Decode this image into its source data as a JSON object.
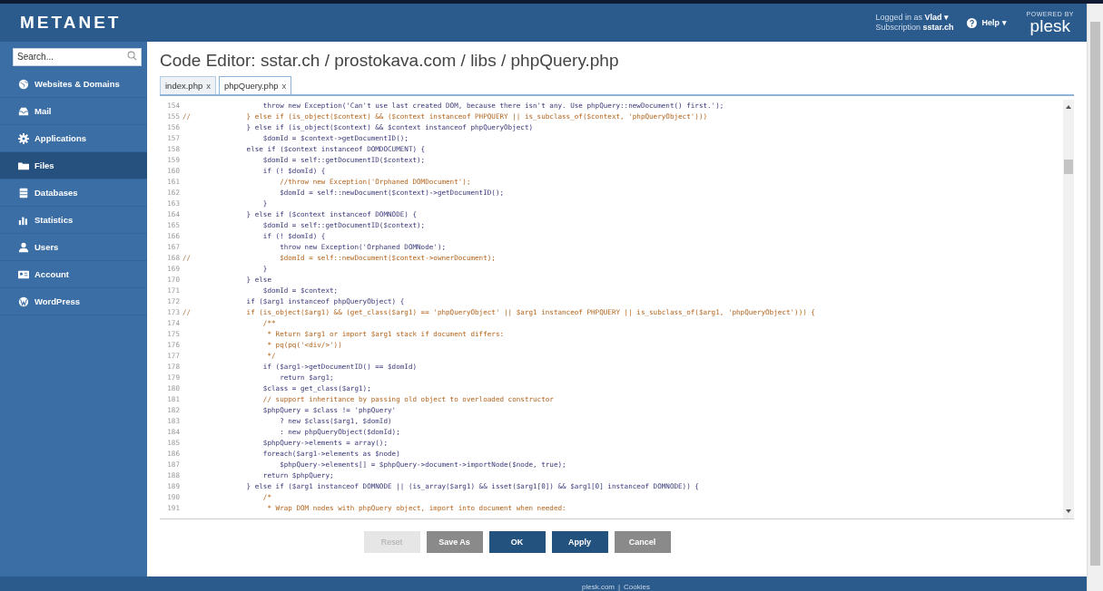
{
  "header": {
    "logo": "METANET",
    "logged_in_label": "Logged in as",
    "user": "Vlad ▾",
    "subscription_label": "Subscription",
    "subscription": "sstar.ch",
    "help": "Help ▾",
    "powered_by": "POWERED BY",
    "brand": "plesk"
  },
  "sidebar": {
    "search": {
      "placeholder": "Search..."
    },
    "items": [
      {
        "label": "Websites & Domains",
        "selected": false
      },
      {
        "label": "Mail",
        "selected": false
      },
      {
        "label": "Applications",
        "selected": false
      },
      {
        "label": "Files",
        "selected": true
      },
      {
        "label": "Databases",
        "selected": false
      },
      {
        "label": "Statistics",
        "selected": false
      },
      {
        "label": "Users",
        "selected": false
      },
      {
        "label": "Account",
        "selected": false
      },
      {
        "label": "WordPress",
        "selected": false
      }
    ]
  },
  "title": "Code Editor: sstar.ch / prostokava.com / libs / phpQuery.php",
  "tabs": [
    {
      "label": "index.php",
      "close": "x",
      "selected": false
    },
    {
      "label": "phpQuery.php",
      "close": "x",
      "selected": true
    }
  ],
  "editor": {
    "lines": [
      {
        "number": "154",
        "kind": "code",
        "text": "            throw new Exception('Can't use last created DOM, because there isn't any. Use phpQuery::newDocument() first.');"
      },
      {
        "number": "155",
        "marker": "//",
        "kind": "comment",
        "text": "        } else if (is_object($context) && ($context instanceof PHPQUERY || is_subclass_of($context, 'phpQueryObject')))"
      },
      {
        "number": "156",
        "kind": "code",
        "text": "        } else if (is_object($context) && $context instanceof phpQueryObject)"
      },
      {
        "number": "157",
        "kind": "code",
        "text": "            $domId = $context->getDocumentID();"
      },
      {
        "number": "158",
        "kind": "code",
        "text": "        else if ($context instanceof DOMDOCUMENT) {"
      },
      {
        "number": "159",
        "kind": "code",
        "text": "            $domId = self::getDocumentID($context);"
      },
      {
        "number": "160",
        "kind": "code",
        "text": "            if (! $domId) {"
      },
      {
        "number": "161",
        "kind": "comment",
        "text": "                //throw new Exception('Orphaned DOMDocument');"
      },
      {
        "number": "162",
        "kind": "code",
        "text": "                $domId = self::newDocument($context)->getDocumentID();"
      },
      {
        "number": "163",
        "kind": "code",
        "text": "            }"
      },
      {
        "number": "164",
        "kind": "code",
        "text": "        } else if ($context instanceof DOMNODE) {"
      },
      {
        "number": "165",
        "kind": "code",
        "text": "            $domId = self::getDocumentID($context);"
      },
      {
        "number": "166",
        "kind": "code",
        "text": "            if (! $domId) {"
      },
      {
        "number": "167",
        "kind": "code",
        "text": "                throw new Exception('Orphaned DOMNode');"
      },
      {
        "number": "168",
        "marker": "//",
        "kind": "comment",
        "text": "                $domId = self::newDocument($context->ownerDocument);"
      },
      {
        "number": "169",
        "kind": "code",
        "text": "            }"
      },
      {
        "number": "170",
        "kind": "code",
        "text": "        } else"
      },
      {
        "number": "171",
        "kind": "code",
        "text": "            $domId = $context;"
      },
      {
        "number": "172",
        "kind": "code",
        "text": "        if ($arg1 instanceof phpQueryObject) {"
      },
      {
        "number": "173",
        "marker": "//",
        "kind": "comment",
        "text": "        if (is_object($arg1) && (get_class($arg1) == 'phpQueryObject' || $arg1 instanceof PHPQUERY || is_subclass_of($arg1, 'phpQueryObject'))) {"
      },
      {
        "number": "174",
        "kind": "comment",
        "text": "            /**"
      },
      {
        "number": "175",
        "kind": "comment",
        "text": "             * Return $arg1 or import $arg1 stack if document differs:"
      },
      {
        "number": "176",
        "kind": "comment",
        "text": "             * pq(pq('<div/>'))"
      },
      {
        "number": "177",
        "kind": "comment",
        "text": "             */"
      },
      {
        "number": "178",
        "kind": "code",
        "text": "            if ($arg1->getDocumentID() == $domId)"
      },
      {
        "number": "179",
        "kind": "code",
        "text": "                return $arg1;"
      },
      {
        "number": "180",
        "kind": "code",
        "text": "            $class = get_class($arg1);"
      },
      {
        "number": "181",
        "kind": "comment",
        "text": "            // support inheritance by passing old object to overloaded constructor"
      },
      {
        "number": "182",
        "kind": "code",
        "text": "            $phpQuery = $class != 'phpQuery'"
      },
      {
        "number": "183",
        "kind": "code",
        "text": "                ? new $class($arg1, $domId)"
      },
      {
        "number": "184",
        "kind": "code",
        "text": "                : new phpQueryObject($domId);"
      },
      {
        "number": "185",
        "kind": "code",
        "text": "            $phpQuery->elements = array();"
      },
      {
        "number": "186",
        "kind": "code",
        "text": "            foreach($arg1->elements as $node)"
      },
      {
        "number": "187",
        "kind": "code",
        "text": "                $phpQuery->elements[] = $phpQuery->document->importNode($node, true);"
      },
      {
        "number": "188",
        "kind": "code",
        "text": "            return $phpQuery;"
      },
      {
        "number": "189",
        "kind": "code",
        "text": "        } else if ($arg1 instanceof DOMNODE || (is_array($arg1) && isset($arg1[0]) && $arg1[0] instanceof DOMNODE)) {"
      },
      {
        "number": "190",
        "kind": "comment",
        "text": "            /*"
      },
      {
        "number": "191",
        "kind": "comment",
        "text": "             * Wrap DOM nodes with phpQuery object, import into document when needed:"
      }
    ]
  },
  "buttons": [
    {
      "label": "Reset",
      "kind": "secondary",
      "disabled": true
    },
    {
      "label": "Save As",
      "kind": "secondary",
      "disabled": false
    },
    {
      "label": "OK",
      "kind": "primary",
      "disabled": false
    },
    {
      "label": "Apply",
      "kind": "primary",
      "disabled": false
    },
    {
      "label": "Cancel",
      "kind": "secondary",
      "disabled": false
    }
  ],
  "footer": {
    "links": [
      "plesk.com",
      "Cookies"
    ],
    "separator": "|"
  }
}
